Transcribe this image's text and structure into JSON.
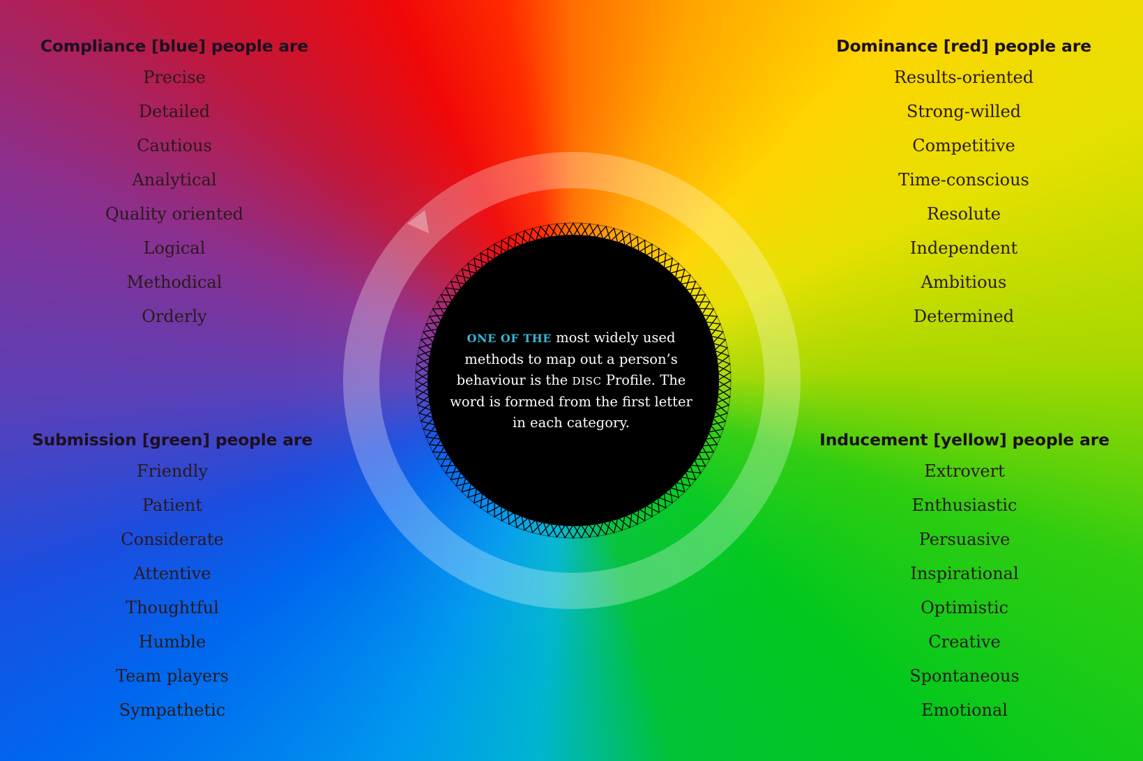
{
  "center": {
    "lead": "ONE OF THE",
    "text_1": " most widely used methods to map out a person’s behaviour is the ",
    "acronym": "DISC",
    "text_2": " Profile. The word is formed from the first letter in each category."
  },
  "groups": {
    "compliance": {
      "heading": "Compliance [blue] people are",
      "traits": [
        "Precise",
        "Detailed",
        "Cautious",
        "Analytical",
        "Quality oriented",
        "Logical",
        "Methodical",
        "Orderly"
      ]
    },
    "dominance": {
      "heading": "Dominance [red] people are",
      "traits": [
        "Results-oriented",
        "Strong-willed",
        "Competitive",
        "Time-conscious",
        "Resolute",
        "Independent",
        "Ambitious",
        "Determined"
      ]
    },
    "submission": {
      "heading": "Submission [green] people are",
      "traits": [
        "Friendly",
        "Patient",
        "Considerate",
        "Attentive",
        "Thoughtful",
        "Humble",
        "Team players",
        "Sympathetic"
      ]
    },
    "inducement": {
      "heading": "Inducement [yellow] people are",
      "traits": [
        "Extrovert",
        "Enthusiastic",
        "Persuasive",
        "Inspirational",
        "Optimistic",
        "Creative",
        "Spontaneous",
        "Emotional"
      ]
    }
  },
  "colors": {
    "center_fill": "#000000",
    "lead_accent": "#35b7d6",
    "ring": "rgba(255,255,255,0.28)"
  }
}
